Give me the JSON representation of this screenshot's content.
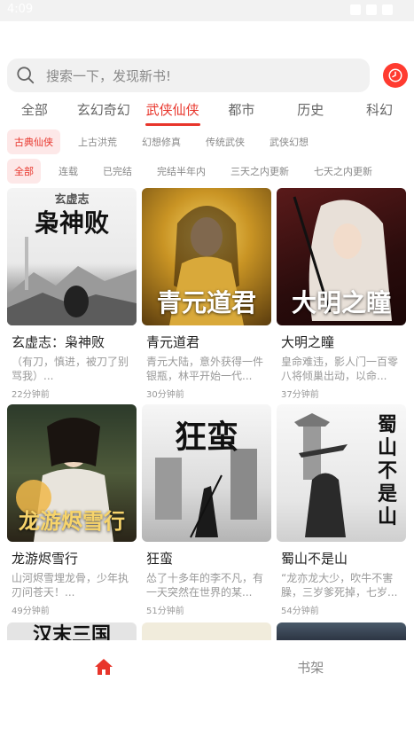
{
  "status": {
    "time": "4:09"
  },
  "search": {
    "placeholder": "搜索一下，发现新书!"
  },
  "category_tabs": [
    "全部",
    "玄幻奇幻",
    "武侠仙侠",
    "都市",
    "历史",
    "科幻"
  ],
  "active_category": "武侠仙侠",
  "sub_categories": [
    "古典仙侠",
    "上古洪荒",
    "幻想修真",
    "传统武侠",
    "武侠幻想"
  ],
  "status_filters": [
    "全部",
    "连载",
    "已完结",
    "完结半年内",
    "三天之内更新",
    "七天之内更新"
  ],
  "books": [
    {
      "title": "玄虚志：枭神败",
      "cover_text": "枭神败",
      "cover_small": "玄虚志",
      "desc": "（有刀，慎进，被刀了别骂我）...",
      "time": "22分钟前"
    },
    {
      "title": "青元道君",
      "cover_text": "青元道君",
      "desc": "青元大陆，意外获得一件银瓶，林平开始一代...",
      "time": "30分钟前"
    },
    {
      "title": "大明之瞳",
      "cover_text": "大明之瞳",
      "desc": "皇命难违，影人门一百零八将倾巢出动，以命...",
      "time": "37分钟前"
    },
    {
      "title": "龙游烬雪行",
      "cover_text": "龙游烬雪行",
      "desc": "山河烬雪埋龙骨，少年执刃问苍天！...",
      "time": "49分钟前"
    },
    {
      "title": "狂蛮",
      "cover_text": "狂蛮",
      "desc": "怂了十多年的李不凡，有一天突然在世界的某...",
      "time": "51分钟前"
    },
    {
      "title": "蜀山不是山",
      "cover_text": "蜀山不是山",
      "desc": "“龙亦龙大少，吹牛不害臊，三岁爹死掉，七岁...",
      "time": "54分钟前"
    }
  ],
  "peek_books": [
    {
      "cover_text": "汉末三国"
    },
    {
      "cover_text": ""
    },
    {
      "cover_text": ""
    }
  ],
  "bottom_nav": {
    "home_icon": "home-icon",
    "bookshelf_label": "书架"
  },
  "colors": {
    "accent": "#e8352b",
    "accent_bg": "#fde8e8"
  }
}
